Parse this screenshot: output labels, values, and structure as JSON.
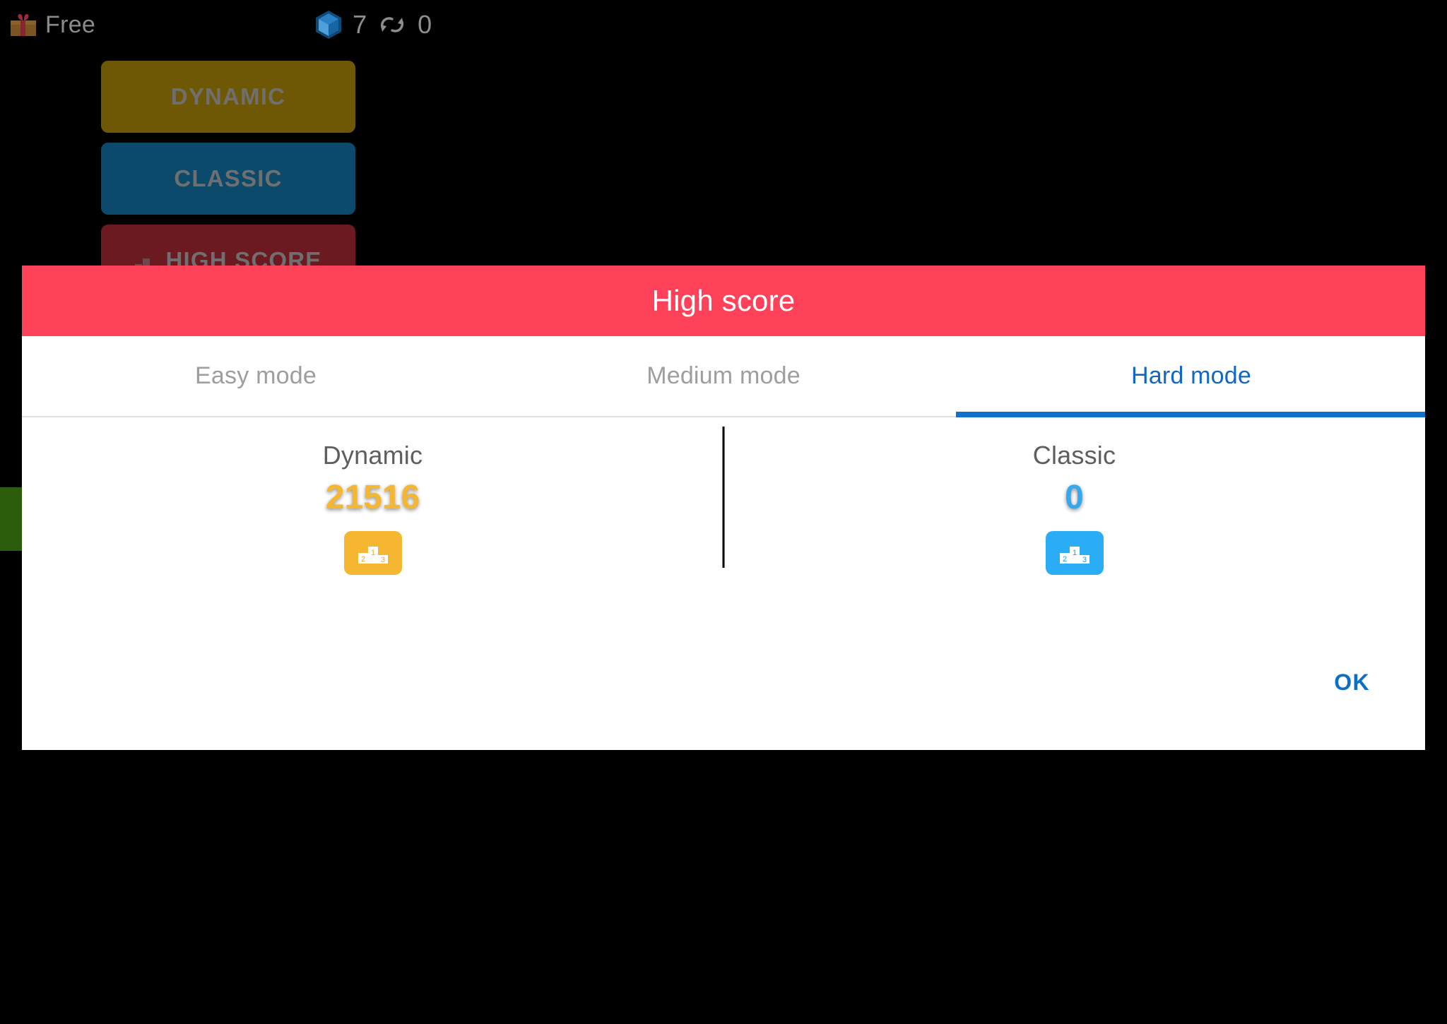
{
  "topbar": {
    "gift_icon": "gift-icon",
    "free_label": "Free",
    "gem_icon": "gem-icon",
    "gem_count": "7",
    "sync_icon": "sync-refresh-icon",
    "sync_count": "0"
  },
  "menu": {
    "buttons": [
      {
        "label": "DYNAMIC",
        "color": "#6e5806",
        "icon": null
      },
      {
        "label": "CLASSIC",
        "color": "#0b4a6b",
        "icon": null
      },
      {
        "label": "HIGH SCORE",
        "color": "#6b1a22",
        "icon": "podium-icon"
      }
    ]
  },
  "dialog": {
    "title": "High score",
    "header_color": "#fd4259",
    "tabs": [
      {
        "label": "Easy mode",
        "active": false
      },
      {
        "label": "Medium mode",
        "active": false
      },
      {
        "label": "Hard mode",
        "active": true
      }
    ],
    "active_tab_color": "#1266c6",
    "indicator_color": "#0e72ca",
    "scores": [
      {
        "mode": "Dynamic",
        "value": "21516",
        "color": "#f5b731",
        "button_color": "#f5b731",
        "button_icon": "podium-icon"
      },
      {
        "mode": "Classic",
        "value": "0",
        "color": "#34a9f0",
        "button_color": "#2badf5",
        "button_icon": "podium-icon"
      }
    ],
    "ok_label": "OK",
    "ok_color": "#0b6fc8"
  }
}
